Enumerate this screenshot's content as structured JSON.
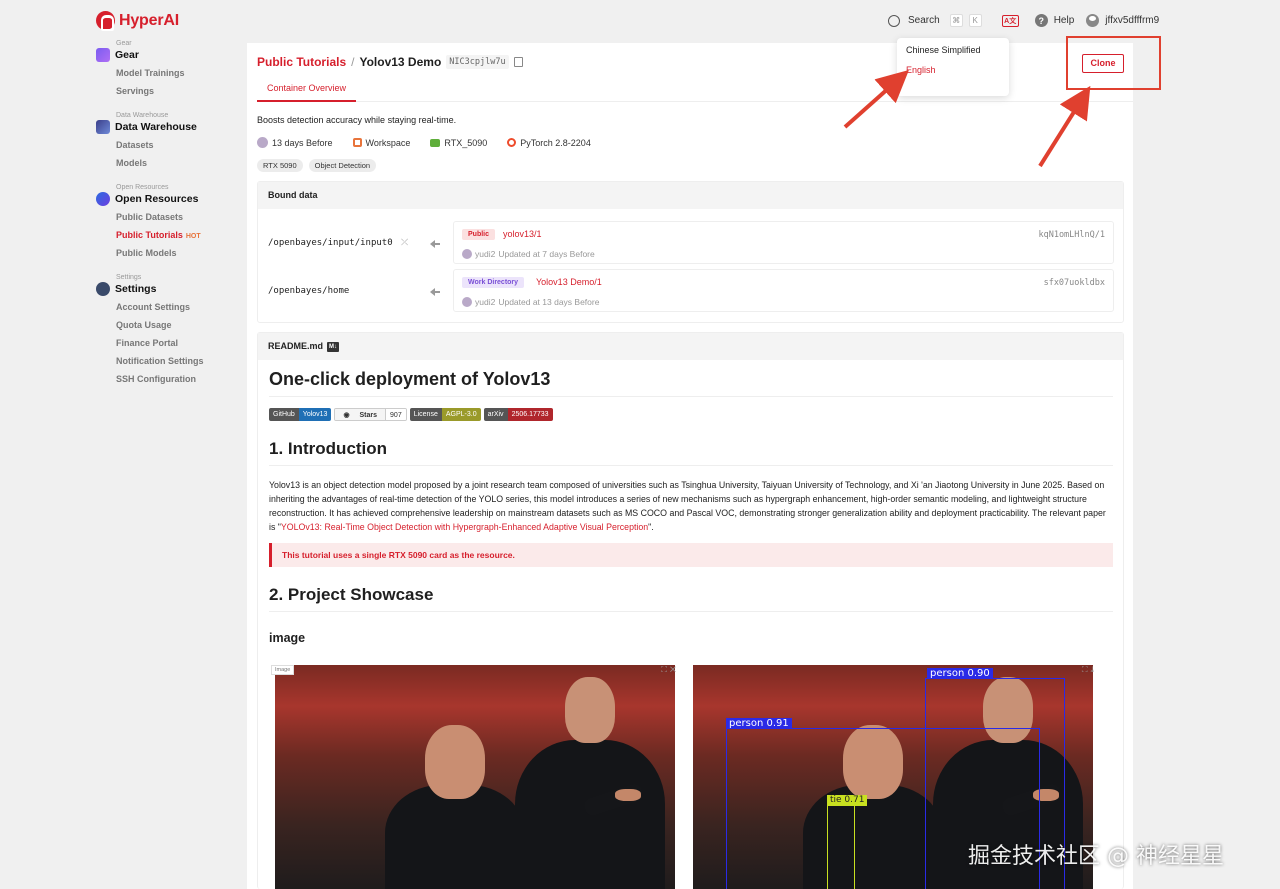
{
  "app": {
    "name": "HyperAI"
  },
  "topbar": {
    "search_label": "Search",
    "search_kbd": [
      "⌘",
      "K"
    ],
    "language_icon": "language-icon",
    "help_label": "Help",
    "username": "jffxv5dfffrm9"
  },
  "language_menu": {
    "options": [
      "Chinese Simplified",
      "English"
    ],
    "selected": "English"
  },
  "sidebar": {
    "groups": [
      {
        "caption": "Gear",
        "title": "Gear",
        "items": [
          "Model Trainings",
          "Servings"
        ]
      },
      {
        "caption": "Data Warehouse",
        "title": "Data Warehouse",
        "items": [
          "Datasets",
          "Models"
        ]
      },
      {
        "caption": "Open Resources",
        "title": "Open Resources",
        "items": [
          "Public Datasets",
          "Public Tutorials",
          "Public Models"
        ],
        "active": "Public Tutorials",
        "hot_badge": "HOT"
      },
      {
        "caption": "Settings",
        "title": "Settings",
        "items": [
          "Account Settings",
          "Quota Usage",
          "Finance Portal",
          "Notification Settings",
          "SSH Configuration"
        ]
      }
    ]
  },
  "header": {
    "breadcrumb_parent": "Public Tutorials",
    "separator": "/",
    "title": "Yolov13 Demo",
    "id": "NIC3cpjlw7u",
    "clone_label": "Clone"
  },
  "tabs": [
    "Container Overview"
  ],
  "description": "Boosts detection accuracy while staying real-time.",
  "meta": {
    "updated": "13 days Before",
    "workspace": "Workspace",
    "gpu": "RTX_5090",
    "framework": "PyTorch 2.8-2204"
  },
  "tags": [
    "RTX 5090",
    "Object Detection"
  ],
  "bound_data": {
    "title": "Bound data",
    "rows": [
      {
        "path": "/openbayes/input/input0",
        "badge": "Public",
        "name": "yolov13/1",
        "hash": "kqN1omLHlnQ/1",
        "user": "yudi2",
        "updated": "Updated at 7 days Before"
      },
      {
        "path": "/openbayes/home",
        "badge": "Work Directory",
        "name": "Yolov13 Demo/1",
        "hash": "sfx07uokldbx",
        "user": "yudi2",
        "updated": "Updated at 13 days Before"
      }
    ]
  },
  "readme": {
    "file": "README.md",
    "md_badge": "M↓",
    "h1": "One-click deployment of Yolov13",
    "badges": [
      {
        "left": "GitHub",
        "right": "Yolov13",
        "color": "#1f6fb5"
      },
      {
        "left": "Stars",
        "right": "907",
        "color": "#ffffff"
      },
      {
        "left": "License",
        "right": "AGPL-3.0",
        "color": "#9a9a2a"
      },
      {
        "left": "arXiv",
        "right": "2506.17733",
        "color": "#b0262c"
      }
    ],
    "intro_heading": "1. Introduction",
    "intro_text_before": "Yolov13 is an object detection model proposed by a joint research team composed of universities such as Tsinghua University, Taiyuan University of Technology, and Xi 'an Jiaotong University in June 2025. Based on inheriting the advantages of real-time detection of the YOLO series, this model introduces a series of new mechanisms such as hypergraph enhancement, high-order semantic modeling, and lightweight structure reconstruction. It has achieved comprehensive leadership on mainstream datasets such as MS COCO and Pascal VOC, demonstrating stronger generalization ability and deployment practicability. The relevant paper is \"",
    "intro_link": "YOLOv13: Real-Time Object Detection with Hypergraph-Enhanced Adaptive Visual Perception",
    "intro_text_after": "\".",
    "callout": "This tutorial uses a single RTX 5090 card as the resource.",
    "showcase_heading": "2. Project Showcase",
    "image_heading": "image",
    "image_label": "Image",
    "detections": [
      {
        "label": "person 0.90"
      },
      {
        "label": "person 0.91"
      },
      {
        "label": "tie 0.71"
      }
    ]
  },
  "watermark": "掘金技术社区 @ 神经星星",
  "colors": {
    "accent": "#d61f2c",
    "annotation": "#e0402f"
  }
}
